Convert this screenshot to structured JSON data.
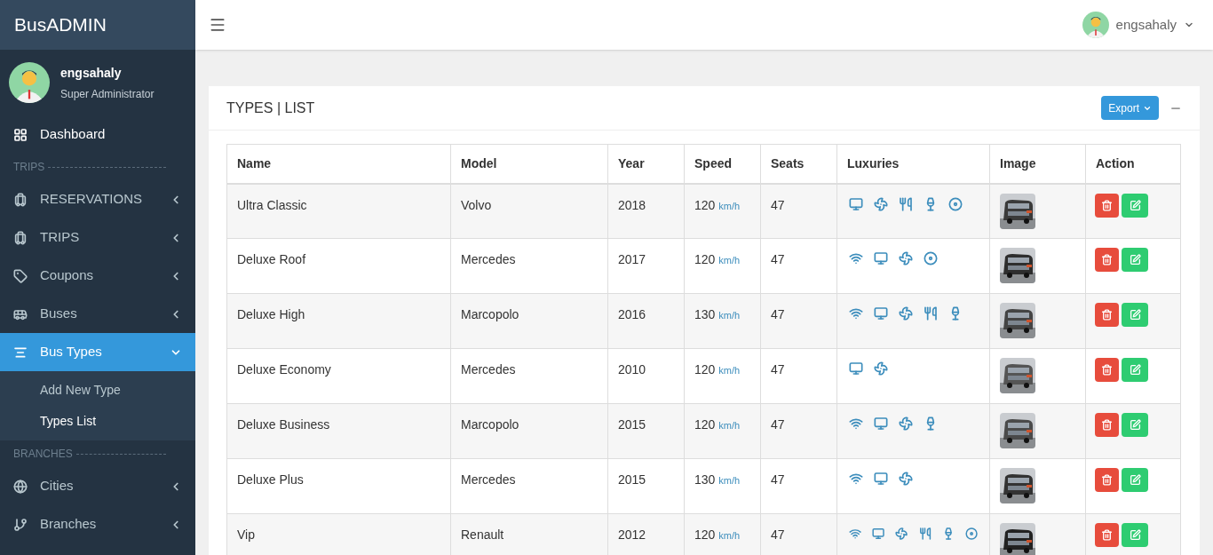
{
  "brand": "BusADMIN",
  "user": {
    "name": "engsahaly",
    "role": "Super Administrator"
  },
  "sidebar": {
    "items": [
      {
        "kind": "link",
        "label": "Dashboard",
        "selected": false
      },
      {
        "kind": "heading",
        "label": "TRIPS"
      },
      {
        "kind": "link",
        "label": "RESERVATIONS",
        "selected": false,
        "expanded": false
      },
      {
        "kind": "link",
        "label": "TRIPS",
        "selected": false,
        "expanded": false
      },
      {
        "kind": "link",
        "label": "Coupons",
        "selected": false,
        "expanded": false
      },
      {
        "kind": "link",
        "label": "Buses",
        "selected": false,
        "expanded": false
      },
      {
        "kind": "link",
        "label": "Bus Types",
        "selected": true,
        "expanded": true,
        "children": [
          {
            "label": "Add New Type",
            "selected": false
          },
          {
            "label": "Types List",
            "selected": true
          }
        ]
      },
      {
        "kind": "heading",
        "label": "BRANCHES"
      },
      {
        "kind": "link",
        "label": "Cities",
        "selected": false,
        "expanded": false
      },
      {
        "kind": "link",
        "label": "Branches",
        "selected": false,
        "expanded": false
      }
    ]
  },
  "header": {
    "user_name": "engsahaly"
  },
  "card": {
    "title": "TYPES | LIST",
    "export_label": "Export"
  },
  "table": {
    "columns": [
      "Name",
      "Model",
      "Year",
      "Speed",
      "Seats",
      "Luxuries",
      "Image",
      "Action"
    ],
    "rows": [
      {
        "name": "Ultra Classic",
        "model": "Volvo",
        "year": "2018",
        "speed": "120",
        "unit": "km/h",
        "seats": "47",
        "luxuries": [
          {
            "kind": "tv"
          },
          {
            "kind": "fan"
          },
          {
            "kind": "food"
          },
          {
            "kind": "drink"
          },
          {
            "kind": "disc"
          }
        ]
      },
      {
        "name": "Deluxe Roof",
        "model": "Mercedes",
        "year": "2017",
        "speed": "120",
        "unit": "km/h",
        "seats": "47",
        "luxuries": [
          {
            "kind": "wifi"
          },
          {
            "kind": "tv"
          },
          {
            "kind": "fan"
          },
          {
            "kind": "disc"
          }
        ]
      },
      {
        "name": "Deluxe High",
        "model": "Marcopolo",
        "year": "2016",
        "speed": "130",
        "unit": "km/h",
        "seats": "47",
        "luxuries": [
          {
            "kind": "wifi"
          },
          {
            "kind": "tv"
          },
          {
            "kind": "fan"
          },
          {
            "kind": "food"
          },
          {
            "kind": "drink"
          }
        ]
      },
      {
        "name": "Deluxe Economy",
        "model": "Mercedes",
        "year": "2010",
        "speed": "120",
        "unit": "km/h",
        "seats": "47",
        "luxuries": [
          {
            "kind": "tv"
          },
          {
            "kind": "fan"
          }
        ]
      },
      {
        "name": "Deluxe Business",
        "model": "Marcopolo",
        "year": "2015",
        "speed": "120",
        "unit": "km/h",
        "seats": "47",
        "luxuries": [
          {
            "kind": "wifi"
          },
          {
            "kind": "tv"
          },
          {
            "kind": "fan"
          },
          {
            "kind": "drink"
          }
        ]
      },
      {
        "name": "Deluxe Plus",
        "model": "Mercedes",
        "year": "2015",
        "speed": "130",
        "unit": "km/h",
        "seats": "47",
        "luxuries": [
          {
            "kind": "wifi"
          },
          {
            "kind": "tv"
          },
          {
            "kind": "fan"
          }
        ]
      },
      {
        "name": "Vip",
        "model": "Renault",
        "year": "2012",
        "speed": "120",
        "unit": "km/h",
        "seats": "47",
        "luxuries": [
          {
            "kind": "wifi"
          },
          {
            "kind": "tv"
          },
          {
            "kind": "fan"
          },
          {
            "kind": "food"
          },
          {
            "kind": "drink"
          },
          {
            "kind": "disc"
          }
        ]
      }
    ]
  }
}
